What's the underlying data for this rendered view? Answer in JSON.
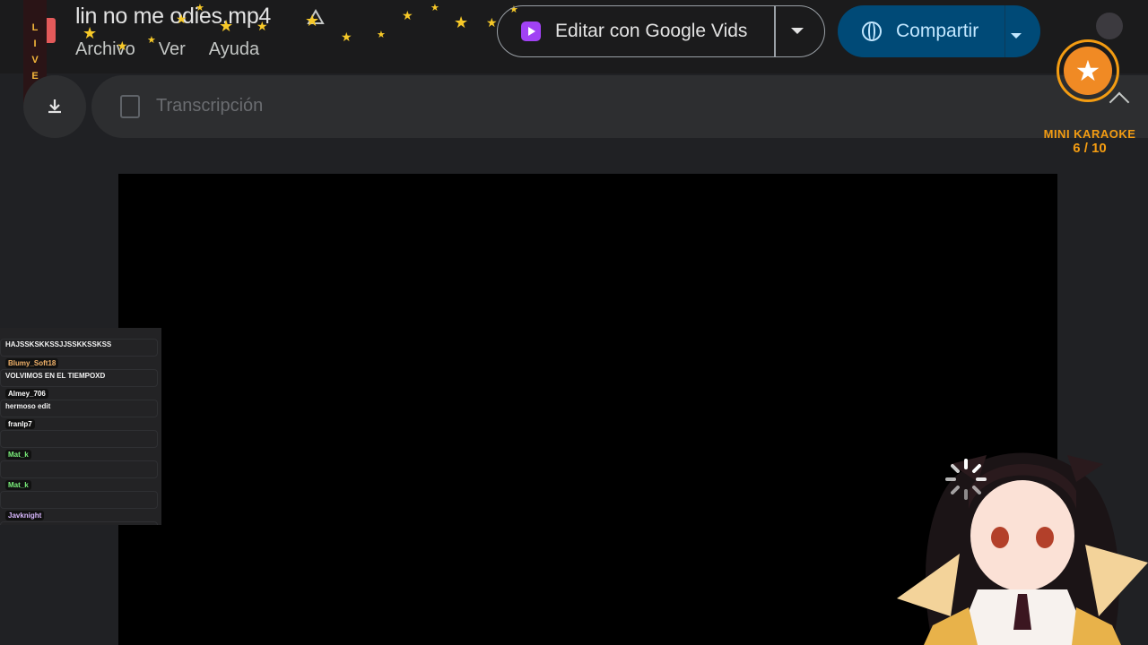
{
  "file": {
    "title": "lin no me odies.mp4"
  },
  "menu": {
    "items": [
      "Archivo",
      "Ver",
      "Ayuda"
    ]
  },
  "live": {
    "letters": [
      "L",
      "I",
      "V",
      "E"
    ]
  },
  "actions": {
    "edit_label": "Editar con Google Vids",
    "share_label": "Compartir"
  },
  "transcript": {
    "label": "Transcripción"
  },
  "karaoke": {
    "title": "MINI KARAOKE",
    "count": "6 / 10"
  },
  "chat": {
    "messages": [
      {
        "user": "",
        "text": "HAJSSKSKKSSJJSSKKSSKSS",
        "user_color": "#ffffff"
      },
      {
        "user": "Blumy_Soft18",
        "text": "VOLVIMOS EN EL TIEMPOXD",
        "user_color": "#f4b46b"
      },
      {
        "user": "Almey_706",
        "text": "hermoso edit",
        "user_color": "#ffffff"
      },
      {
        "user": "franlp7",
        "text": "",
        "user_color": "#ffffff"
      },
      {
        "user": "Mat_k",
        "text": "",
        "user_color": "#7cf27c"
      },
      {
        "user": "Mat_k",
        "text": "",
        "user_color": "#7cf27c"
      },
      {
        "user": "Javknight",
        "text": "",
        "user_color": "#d9b8ff"
      }
    ]
  },
  "colors": {
    "accent_share": "#004a77",
    "vids_purple": "#a142f4",
    "karaoke_orange": "#f39c12",
    "star_yellow": "#f7c928"
  }
}
